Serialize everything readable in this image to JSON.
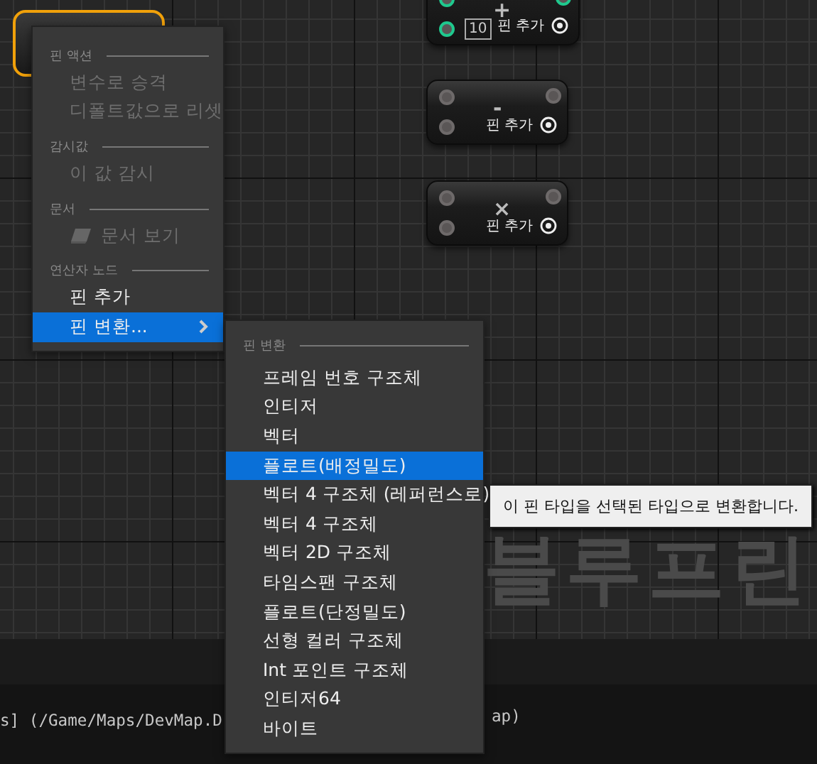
{
  "graph": {
    "nodes": [
      {
        "symbol": "+",
        "default_value": "10",
        "add_pin_label": "핀 추가",
        "color": "#1fc98e"
      },
      {
        "symbol": "-",
        "add_pin_label": "핀 추가",
        "color": "#6e6a6a"
      },
      {
        "symbol": "×",
        "add_pin_label": "핀 추가",
        "color": "#6e6a6a"
      }
    ],
    "graph_label": "블루프린"
  },
  "context_menu": {
    "sections": [
      {
        "header": "핀 액션",
        "items": [
          {
            "label": "변수로 승격",
            "disabled": true,
            "selected": false,
            "kind": "plain"
          },
          {
            "label": "디폴트값으로 리셋",
            "disabled": true,
            "selected": false,
            "kind": "plain"
          }
        ]
      },
      {
        "header": "감시값",
        "items": [
          {
            "label": "이 값 감시",
            "disabled": true,
            "selected": false,
            "kind": "plain"
          }
        ]
      },
      {
        "header": "문서",
        "items": [
          {
            "label": "문서 보기",
            "disabled": true,
            "selected": false,
            "kind": "with_icon"
          }
        ]
      },
      {
        "header": "연산자 노드",
        "items": [
          {
            "label": "핀 추가",
            "disabled": false,
            "selected": false,
            "kind": "plain"
          },
          {
            "label": "핀 변환...",
            "disabled": false,
            "selected": true,
            "kind": "submenu"
          }
        ]
      }
    ]
  },
  "submenu": {
    "header": "핀 변환",
    "items": [
      {
        "label": "프레임 번호 구조체",
        "selected": false
      },
      {
        "label": "인티저",
        "selected": false
      },
      {
        "label": "벡터",
        "selected": false
      },
      {
        "label": "플로트(배정밀도)",
        "selected": true
      },
      {
        "label": "벡터 4 구조체 (레퍼런스로)",
        "selected": false
      },
      {
        "label": "벡터 4 구조체",
        "selected": false
      },
      {
        "label": "벡터 2D 구조체",
        "selected": false
      },
      {
        "label": "타임스팬 구조체",
        "selected": false
      },
      {
        "label": "플로트(단정밀도)",
        "selected": false
      },
      {
        "label": "선형 컬러 구조체",
        "selected": false
      },
      {
        "label": "Int 포인트 구조체",
        "selected": false
      },
      {
        "label": "인티저64",
        "selected": false
      },
      {
        "label": "바이트",
        "selected": false
      }
    ]
  },
  "tooltip": "이 핀 타입을 선택된 타입으로 변환합니다.",
  "output_log": {
    "line_start": "s] (/Game/Maps/DevMap.D",
    "line_end": "ap)"
  }
}
